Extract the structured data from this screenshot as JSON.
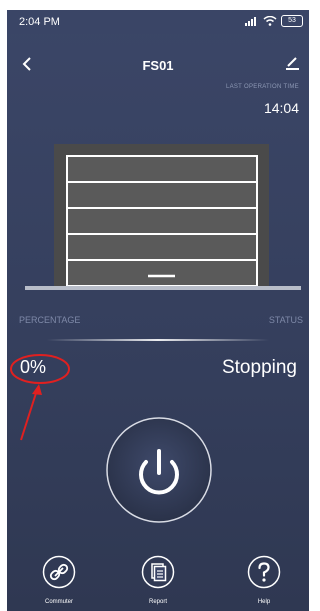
{
  "status_bar": {
    "time": "2:04 PM",
    "battery": "53"
  },
  "header": {
    "title": "FS01",
    "back_icon": "chevron-left-icon",
    "edit_icon": "pencil-icon"
  },
  "last_operation": {
    "label": "LAST OPERATION TIME",
    "value": "14:04"
  },
  "door": {
    "open_fraction": 0
  },
  "info": {
    "percentage_label": "PERCENTAGE",
    "status_label": "STATUS",
    "percentage_value": "0%",
    "status_value": "Stopping"
  },
  "power": {
    "icon": "power-icon"
  },
  "nav": {
    "items": [
      {
        "label": "Commuter",
        "icon": "link-icon"
      },
      {
        "label": "Report",
        "icon": "report-icon"
      },
      {
        "label": "Help",
        "icon": "help-icon"
      }
    ]
  },
  "colors": {
    "background": "#3b4667",
    "door_panel": "#4a4a4a",
    "annotation": "#e02020"
  }
}
